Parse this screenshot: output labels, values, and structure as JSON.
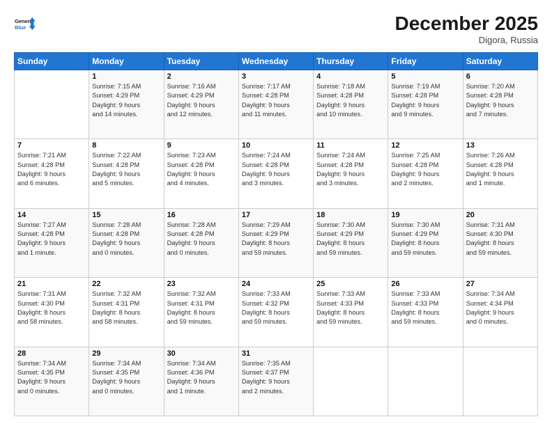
{
  "logo": {
    "line1": "General",
    "line2": "Blue"
  },
  "title": "December 2025",
  "location": "Digora, Russia",
  "days_header": [
    "Sunday",
    "Monday",
    "Tuesday",
    "Wednesday",
    "Thursday",
    "Friday",
    "Saturday"
  ],
  "weeks": [
    [
      {
        "day": "",
        "info": ""
      },
      {
        "day": "1",
        "info": "Sunrise: 7:15 AM\nSunset: 4:29 PM\nDaylight: 9 hours\nand 14 minutes."
      },
      {
        "day": "2",
        "info": "Sunrise: 7:16 AM\nSunset: 4:29 PM\nDaylight: 9 hours\nand 12 minutes."
      },
      {
        "day": "3",
        "info": "Sunrise: 7:17 AM\nSunset: 4:28 PM\nDaylight: 9 hours\nand 11 minutes."
      },
      {
        "day": "4",
        "info": "Sunrise: 7:18 AM\nSunset: 4:28 PM\nDaylight: 9 hours\nand 10 minutes."
      },
      {
        "day": "5",
        "info": "Sunrise: 7:19 AM\nSunset: 4:28 PM\nDaylight: 9 hours\nand 9 minutes."
      },
      {
        "day": "6",
        "info": "Sunrise: 7:20 AM\nSunset: 4:28 PM\nDaylight: 9 hours\nand 7 minutes."
      }
    ],
    [
      {
        "day": "7",
        "info": "Sunrise: 7:21 AM\nSunset: 4:28 PM\nDaylight: 9 hours\nand 6 minutes."
      },
      {
        "day": "8",
        "info": "Sunrise: 7:22 AM\nSunset: 4:28 PM\nDaylight: 9 hours\nand 5 minutes."
      },
      {
        "day": "9",
        "info": "Sunrise: 7:23 AM\nSunset: 4:28 PM\nDaylight: 9 hours\nand 4 minutes."
      },
      {
        "day": "10",
        "info": "Sunrise: 7:24 AM\nSunset: 4:28 PM\nDaylight: 9 hours\nand 3 minutes."
      },
      {
        "day": "11",
        "info": "Sunrise: 7:24 AM\nSunset: 4:28 PM\nDaylight: 9 hours\nand 3 minutes."
      },
      {
        "day": "12",
        "info": "Sunrise: 7:25 AM\nSunset: 4:28 PM\nDaylight: 9 hours\nand 2 minutes."
      },
      {
        "day": "13",
        "info": "Sunrise: 7:26 AM\nSunset: 4:28 PM\nDaylight: 9 hours\nand 1 minute."
      }
    ],
    [
      {
        "day": "14",
        "info": "Sunrise: 7:27 AM\nSunset: 4:28 PM\nDaylight: 9 hours\nand 1 minute."
      },
      {
        "day": "15",
        "info": "Sunrise: 7:28 AM\nSunset: 4:28 PM\nDaylight: 9 hours\nand 0 minutes."
      },
      {
        "day": "16",
        "info": "Sunrise: 7:28 AM\nSunset: 4:28 PM\nDaylight: 9 hours\nand 0 minutes."
      },
      {
        "day": "17",
        "info": "Sunrise: 7:29 AM\nSunset: 4:29 PM\nDaylight: 8 hours\nand 59 minutes."
      },
      {
        "day": "18",
        "info": "Sunrise: 7:30 AM\nSunset: 4:29 PM\nDaylight: 8 hours\nand 59 minutes."
      },
      {
        "day": "19",
        "info": "Sunrise: 7:30 AM\nSunset: 4:29 PM\nDaylight: 8 hours\nand 59 minutes."
      },
      {
        "day": "20",
        "info": "Sunrise: 7:31 AM\nSunset: 4:30 PM\nDaylight: 8 hours\nand 59 minutes."
      }
    ],
    [
      {
        "day": "21",
        "info": "Sunrise: 7:31 AM\nSunset: 4:30 PM\nDaylight: 8 hours\nand 58 minutes."
      },
      {
        "day": "22",
        "info": "Sunrise: 7:32 AM\nSunset: 4:31 PM\nDaylight: 8 hours\nand 58 minutes."
      },
      {
        "day": "23",
        "info": "Sunrise: 7:32 AM\nSunset: 4:31 PM\nDaylight: 8 hours\nand 59 minutes."
      },
      {
        "day": "24",
        "info": "Sunrise: 7:33 AM\nSunset: 4:32 PM\nDaylight: 8 hours\nand 59 minutes."
      },
      {
        "day": "25",
        "info": "Sunrise: 7:33 AM\nSunset: 4:33 PM\nDaylight: 8 hours\nand 59 minutes."
      },
      {
        "day": "26",
        "info": "Sunrise: 7:33 AM\nSunset: 4:33 PM\nDaylight: 8 hours\nand 59 minutes."
      },
      {
        "day": "27",
        "info": "Sunrise: 7:34 AM\nSunset: 4:34 PM\nDaylight: 9 hours\nand 0 minutes."
      }
    ],
    [
      {
        "day": "28",
        "info": "Sunrise: 7:34 AM\nSunset: 4:35 PM\nDaylight: 9 hours\nand 0 minutes."
      },
      {
        "day": "29",
        "info": "Sunrise: 7:34 AM\nSunset: 4:35 PM\nDaylight: 9 hours\nand 0 minutes."
      },
      {
        "day": "30",
        "info": "Sunrise: 7:34 AM\nSunset: 4:36 PM\nDaylight: 9 hours\nand 1 minute."
      },
      {
        "day": "31",
        "info": "Sunrise: 7:35 AM\nSunset: 4:37 PM\nDaylight: 9 hours\nand 2 minutes."
      },
      {
        "day": "",
        "info": ""
      },
      {
        "day": "",
        "info": ""
      },
      {
        "day": "",
        "info": ""
      }
    ]
  ]
}
